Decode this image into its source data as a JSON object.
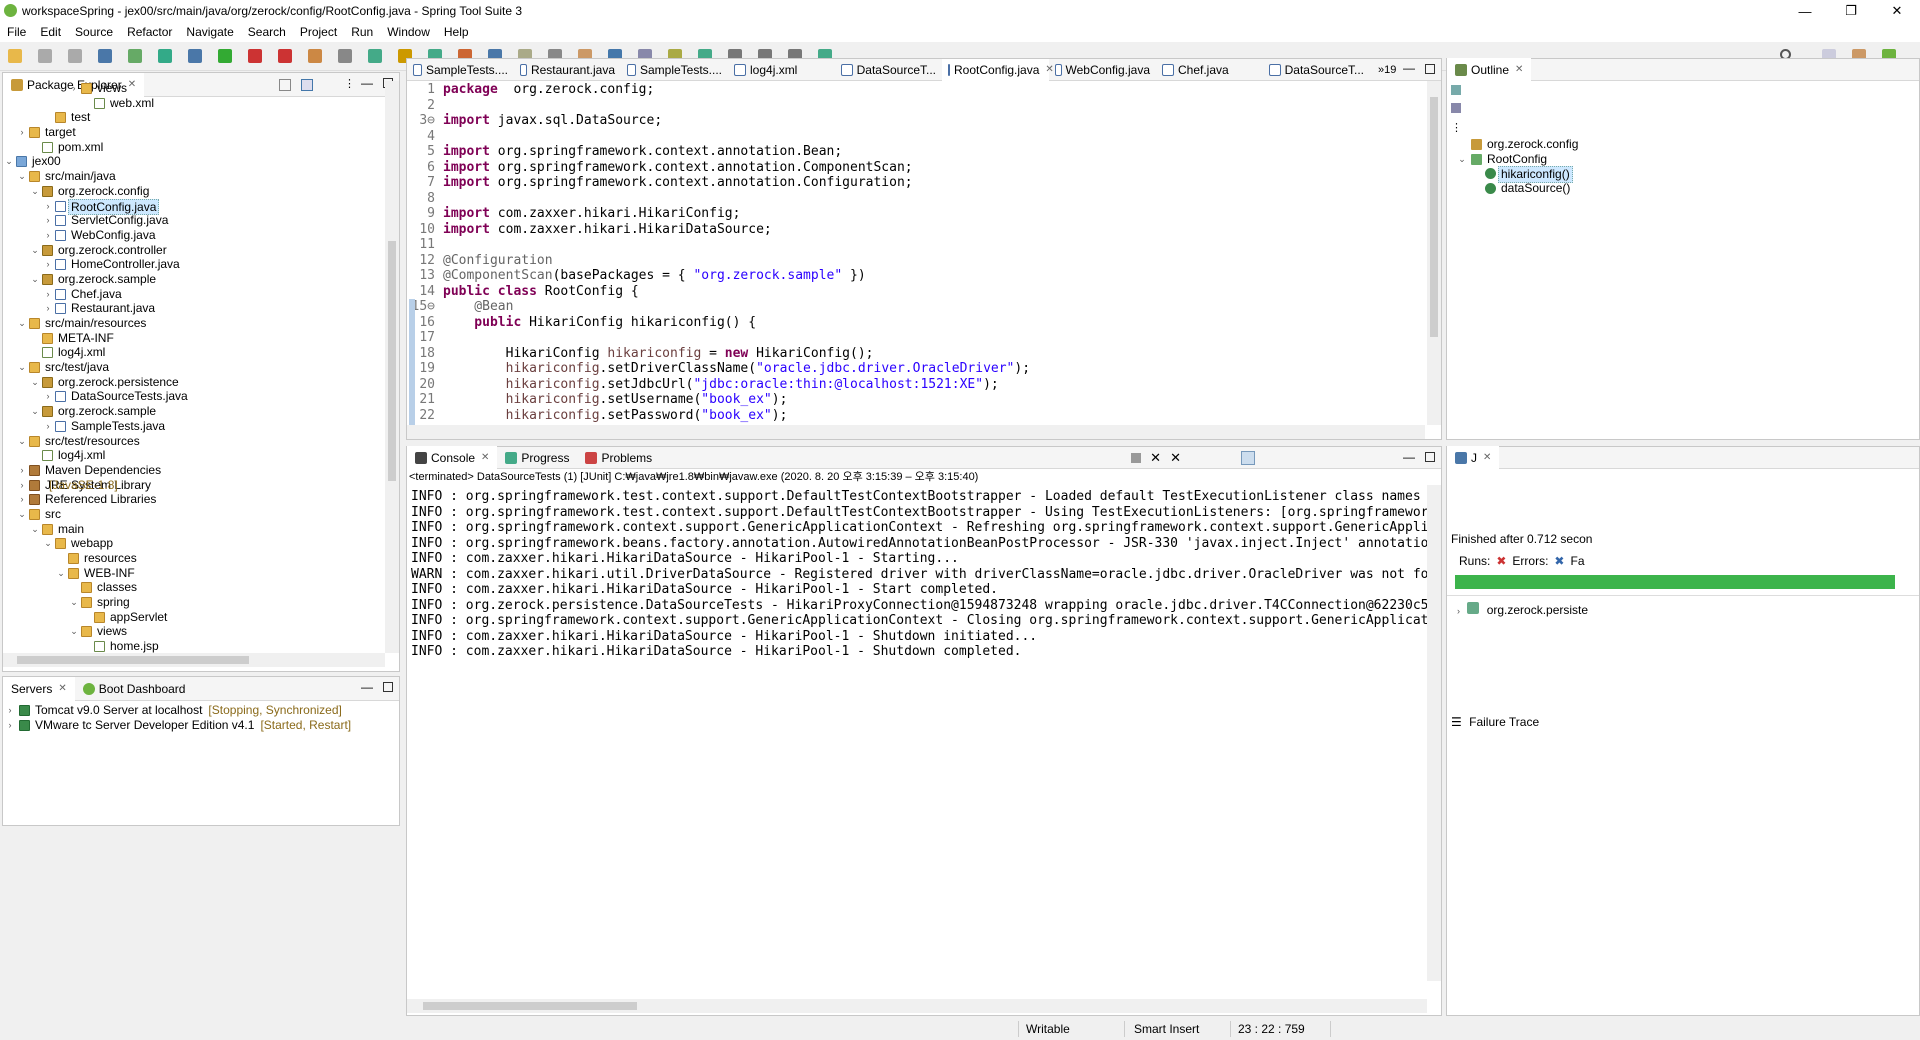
{
  "window": {
    "title": "workspaceSpring - jex00/src/main/java/org/zerock/config/RootConfig.java - Spring Tool Suite 3",
    "min": "—",
    "max": "❐",
    "close": "✕"
  },
  "menu": [
    "File",
    "Edit",
    "Source",
    "Refactor",
    "Navigate",
    "Search",
    "Project",
    "Run",
    "Window",
    "Help"
  ],
  "package_explorer": {
    "title": "Package Explorer",
    "tree": [
      {
        "indent": 6,
        "arrow": "›",
        "icon": "folder",
        "label": "views"
      },
      {
        "indent": 7,
        "arrow": "",
        "icon": "xml",
        "label": "web.xml"
      },
      {
        "indent": 4,
        "arrow": "",
        "icon": "folder",
        "label": "test"
      },
      {
        "indent": 2,
        "arrow": "›",
        "icon": "folder",
        "label": "target"
      },
      {
        "indent": 3,
        "arrow": "",
        "icon": "xml",
        "label": "pom.xml"
      },
      {
        "indent": 1,
        "arrow": "⌄",
        "icon": "proj",
        "label": "jex00"
      },
      {
        "indent": 2,
        "arrow": "⌄",
        "icon": "folder",
        "label": "src/main/java"
      },
      {
        "indent": 3,
        "arrow": "⌄",
        "icon": "pkg",
        "label": "org.zerock.config"
      },
      {
        "indent": 4,
        "arrow": "›",
        "icon": "java",
        "label": "RootConfig.java",
        "selected": true
      },
      {
        "indent": 4,
        "arrow": "›",
        "icon": "java",
        "label": "ServletConfig.java"
      },
      {
        "indent": 4,
        "arrow": "›",
        "icon": "java",
        "label": "WebConfig.java"
      },
      {
        "indent": 3,
        "arrow": "⌄",
        "icon": "pkg",
        "label": "org.zerock.controller"
      },
      {
        "indent": 4,
        "arrow": "›",
        "icon": "java",
        "label": "HomeController.java"
      },
      {
        "indent": 3,
        "arrow": "⌄",
        "icon": "pkg",
        "label": "org.zerock.sample"
      },
      {
        "indent": 4,
        "arrow": "›",
        "icon": "java",
        "label": "Chef.java"
      },
      {
        "indent": 4,
        "arrow": "›",
        "icon": "java",
        "label": "Restaurant.java"
      },
      {
        "indent": 2,
        "arrow": "⌄",
        "icon": "folder",
        "label": "src/main/resources"
      },
      {
        "indent": 3,
        "arrow": "",
        "icon": "folder",
        "label": "META-INF"
      },
      {
        "indent": 3,
        "arrow": "",
        "icon": "xml",
        "label": "log4j.xml"
      },
      {
        "indent": 2,
        "arrow": "⌄",
        "icon": "folder",
        "label": "src/test/java"
      },
      {
        "indent": 3,
        "arrow": "⌄",
        "icon": "pkg",
        "label": "org.zerock.persistence"
      },
      {
        "indent": 4,
        "arrow": "›",
        "icon": "java",
        "label": "DataSourceTests.java"
      },
      {
        "indent": 3,
        "arrow": "⌄",
        "icon": "pkg",
        "label": "org.zerock.sample"
      },
      {
        "indent": 4,
        "arrow": "›",
        "icon": "java",
        "label": "SampleTests.java"
      },
      {
        "indent": 2,
        "arrow": "⌄",
        "icon": "folder",
        "label": "src/test/resources"
      },
      {
        "indent": 3,
        "arrow": "",
        "icon": "xml",
        "label": "log4j.xml"
      },
      {
        "indent": 2,
        "arrow": "›",
        "icon": "jar",
        "label": "Maven Dependencies"
      },
      {
        "indent": 2,
        "arrow": "›",
        "icon": "jar",
        "label": "JRE System Library",
        "suffix": "[JavaSE-1.8]"
      },
      {
        "indent": 2,
        "arrow": "›",
        "icon": "jar",
        "label": "Referenced Libraries"
      },
      {
        "indent": 2,
        "arrow": "⌄",
        "icon": "folder",
        "label": "src"
      },
      {
        "indent": 3,
        "arrow": "⌄",
        "icon": "folder",
        "label": "main"
      },
      {
        "indent": 4,
        "arrow": "⌄",
        "icon": "folder",
        "label": "webapp"
      },
      {
        "indent": 5,
        "arrow": "",
        "icon": "folder",
        "label": "resources"
      },
      {
        "indent": 5,
        "arrow": "⌄",
        "icon": "folder",
        "label": "WEB-INF"
      },
      {
        "indent": 6,
        "arrow": "",
        "icon": "folder",
        "label": "classes"
      },
      {
        "indent": 6,
        "arrow": "⌄",
        "icon": "folder",
        "label": "spring"
      },
      {
        "indent": 7,
        "arrow": "",
        "icon": "folder",
        "label": "appServlet"
      },
      {
        "indent": 6,
        "arrow": "⌄",
        "icon": "folder",
        "label": "views"
      },
      {
        "indent": 7,
        "arrow": "",
        "icon": "xml",
        "label": "home.jsp"
      }
    ]
  },
  "servers": {
    "tabs": [
      "Servers",
      "Boot Dashboard"
    ],
    "items": [
      {
        "label": "Tomcat v9.0 Server at localhost",
        "status": "[Stopping, Synchronized]"
      },
      {
        "label": "VMware tc Server Developer Edition v4.1",
        "status": "[Started, Restart]"
      }
    ]
  },
  "editor": {
    "tabs": [
      "SampleTests....",
      "Restaurant.java",
      "SampleTests....",
      "log4j.xml",
      "DataSourceT...",
      "RootConfig.java",
      "WebConfig.java",
      "Chef.java",
      "DataSourceT..."
    ],
    "active_tab": 5,
    "overflow": "»19",
    "lines": [
      {
        "n": "1",
        "segs": [
          [
            "kw",
            "package"
          ],
          [
            "",
            "  org.zerock.config;"
          ]
        ]
      },
      {
        "n": "2",
        "segs": []
      },
      {
        "n": "3⊖",
        "segs": [
          [
            "kw",
            "import"
          ],
          [
            "",
            " javax.sql.DataSource;"
          ]
        ]
      },
      {
        "n": "4",
        "segs": []
      },
      {
        "n": "5",
        "segs": [
          [
            "kw",
            "import"
          ],
          [
            "",
            " org.springframework.context.annotation.Bean;"
          ]
        ]
      },
      {
        "n": "6",
        "segs": [
          [
            "kw",
            "import"
          ],
          [
            "",
            " org.springframework.context.annotation.ComponentScan;"
          ]
        ]
      },
      {
        "n": "7",
        "segs": [
          [
            "kw",
            "import"
          ],
          [
            "",
            " org.springframework.context.annotation.Configuration;"
          ]
        ]
      },
      {
        "n": "8",
        "segs": []
      },
      {
        "n": "9",
        "segs": [
          [
            "kw",
            "import"
          ],
          [
            "",
            " com.zaxxer.hikari.HikariConfig;"
          ]
        ]
      },
      {
        "n": "10",
        "segs": [
          [
            "kw",
            "import"
          ],
          [
            "",
            " com.zaxxer.hikari.HikariDataSource;"
          ]
        ]
      },
      {
        "n": "11",
        "segs": []
      },
      {
        "n": "12",
        "segs": [
          [
            "ann",
            "@Configuration"
          ]
        ]
      },
      {
        "n": "13",
        "segs": [
          [
            "ann",
            "@ComponentScan"
          ],
          [
            "",
            "(basePackages = { "
          ],
          [
            "str",
            "\"org.zerock.sample\""
          ],
          [
            "",
            " })"
          ]
        ]
      },
      {
        "n": "14",
        "segs": [
          [
            "kw",
            "public class"
          ],
          [
            "",
            " RootConfig {"
          ]
        ]
      },
      {
        "n": "15⊖",
        "segs": [
          [
            "ann",
            "    @Bean"
          ]
        ]
      },
      {
        "n": "16",
        "segs": [
          [
            "kw",
            "    public"
          ],
          [
            "",
            " HikariConfig hikariconfig() {"
          ]
        ]
      },
      {
        "n": "17",
        "segs": []
      },
      {
        "n": "18",
        "segs": [
          [
            "",
            "        HikariConfig "
          ],
          [
            "fld",
            "hikariconfig"
          ],
          [
            "",
            " = "
          ],
          [
            "kw",
            "new"
          ],
          [
            "",
            " HikariConfig();"
          ]
        ]
      },
      {
        "n": "19",
        "segs": [
          [
            "fld",
            "        hikariconfig"
          ],
          [
            "",
            ".setDriverClassName("
          ],
          [
            "str",
            "\"oracle.jdbc.driver.OracleDriver\""
          ],
          [
            "",
            ");"
          ]
        ]
      },
      {
        "n": "20",
        "segs": [
          [
            "fld",
            "        hikariconfig"
          ],
          [
            "",
            ".setJdbcUrl("
          ],
          [
            "str",
            "\"jdbc:oracle:thin:@localhost:1521:XE\""
          ],
          [
            "",
            ");"
          ]
        ]
      },
      {
        "n": "21",
        "segs": [
          [
            "fld",
            "        hikariconfig"
          ],
          [
            "",
            ".setUsername("
          ],
          [
            "str",
            "\"book_ex\""
          ],
          [
            "",
            ");"
          ]
        ]
      },
      {
        "n": "22",
        "segs": [
          [
            "fld",
            "        hikariconfig"
          ],
          [
            "",
            ".setPassword("
          ],
          [
            "str",
            "\"book_ex\""
          ],
          [
            "",
            ");"
          ]
        ]
      }
    ]
  },
  "outline": {
    "title": "Outline",
    "items": [
      {
        "label": "org.zerock.config",
        "indent": 0
      },
      {
        "label": "RootConfig",
        "indent": 0,
        "arrow": "⌄"
      },
      {
        "label": "hikariconfig()",
        "indent": 1,
        "selected": true
      },
      {
        "label": "dataSource()",
        "indent": 1
      }
    ]
  },
  "console": {
    "tabs": [
      "Console",
      "Progress",
      "Problems"
    ],
    "header": "<terminated> DataSourceTests (1) [JUnit] C:₩java₩jre1.8₩bin₩javaw.exe  (2020. 8. 20 오후 3:15:39 – 오후 3:15:40)",
    "lines": [
      "INFO : org.springframework.test.context.support.DefaultTestContextBootstrapper - Loaded default TestExecutionListener class names from loca",
      "INFO : org.springframework.test.context.support.DefaultTestContextBootstrapper - Using TestExecutionListeners: [org.springframework.test.co",
      "INFO : org.springframework.context.support.GenericApplicationContext - Refreshing org.springframework.context.support.GenericApplicationCor",
      "INFO : org.springframework.beans.factory.annotation.AutowiredAnnotationBeanPostProcessor - JSR-330 'javax.inject.Inject' annotation found a",
      "INFO : com.zaxxer.hikari.HikariDataSource - HikariPool-1 - Starting...",
      "WARN : com.zaxxer.hikari.util.DriverDataSource - Registered driver with driverClassName=oracle.jdbc.driver.OracleDriver was not found, tryi",
      "INFO : com.zaxxer.hikari.HikariDataSource - HikariPool-1 - Start completed.",
      "INFO : org.zerock.persistence.DataSourceTests - HikariProxyConnection@1594873248 wrapping oracle.jdbc.driver.T4CConnection@62230c58",
      "INFO : org.springframework.context.support.GenericApplicationContext - Closing org.springframework.context.support.GenericApplicationContex",
      "INFO : com.zaxxer.hikari.HikariDataSource - HikariPool-1 - Shutdown initiated...",
      "INFO : com.zaxxer.hikari.HikariDataSource - HikariPool-1 - Shutdown completed."
    ]
  },
  "junit": {
    "tab": "J",
    "finished": "Finished after 0.712 secon",
    "runs": "Runs:",
    "errors": "Errors:",
    "failures": "Fa",
    "result_color": "#3cb44b",
    "tree_item": "org.zerock.persiste",
    "failure_trace": "Failure Trace"
  },
  "status": {
    "writable": "Writable",
    "insert": "Smart Insert",
    "position": "23 : 22 : 759"
  }
}
